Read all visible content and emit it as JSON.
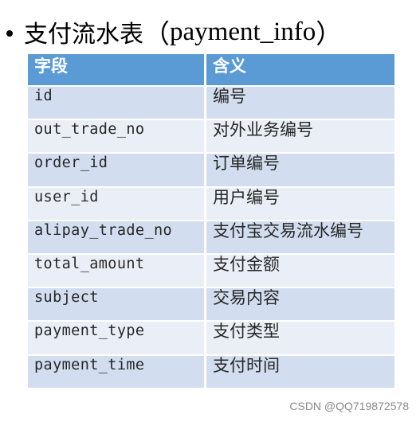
{
  "title": {
    "bullet": "•",
    "text": "支付流水表",
    "paren_open": "（",
    "table_name": "payment_info",
    "paren_close": "）"
  },
  "table": {
    "columns": [
      "字段",
      "含义"
    ],
    "rows": [
      {
        "field": "id",
        "meaning": "编号"
      },
      {
        "field": "out_trade_no",
        "meaning": "对外业务编号"
      },
      {
        "field": "order_id",
        "meaning": "订单编号"
      },
      {
        "field": "user_id",
        "meaning": "用户编号"
      },
      {
        "field": "alipay_trade_no",
        "meaning": "支付宝交易流水编号"
      },
      {
        "field": "total_amount",
        "meaning": "支付金额"
      },
      {
        "field": "subject",
        "meaning": "交易内容"
      },
      {
        "field": "payment_type",
        "meaning": "支付类型"
      },
      {
        "field": "payment_time",
        "meaning": "支付时间"
      }
    ]
  },
  "colors": {
    "header_bg": "#5B9BD5",
    "row_odd_bg": "#D2DEEF",
    "row_even_bg": "#EAEFF7",
    "header_text": "#FFFFFF"
  },
  "watermark": "CSDN @QQ719872578"
}
